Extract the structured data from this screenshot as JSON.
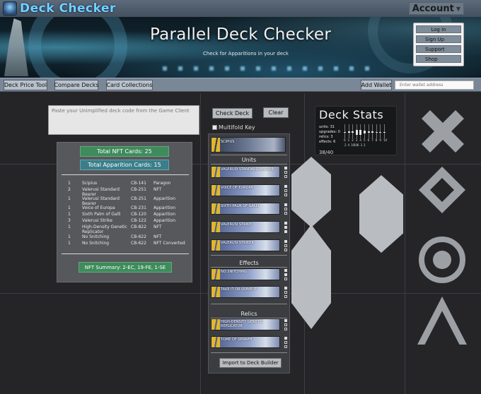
{
  "app": {
    "title": "Deck Checker",
    "account_label": "Account"
  },
  "banner": {
    "title": "Parallel Deck Checker",
    "subtitle": "Check for Apparitions in your deck"
  },
  "auth": {
    "login": "Log In",
    "signup": "Sign Up",
    "support": "Support",
    "shop": "Shop"
  },
  "toolbar": {
    "price_tool": "Deck Price Tool",
    "compare": "Compare Decks",
    "collections": "Card Collections",
    "add_wallet": "Add Wallet",
    "wallet_placeholder": "Enter wallet address"
  },
  "paste": {
    "placeholder": "Paste your Unimplified deck code from the Game Client"
  },
  "nft_panel": {
    "total_nft": "Total NFT Cards: 25",
    "total_apparition": "Total Apparition Cards: 15",
    "cards": [
      {
        "qty": "1",
        "name": "Scipius",
        "code": "CB-141",
        "type": "Paragon"
      },
      {
        "qty": "2",
        "name": "Valerusi Standard Bearer",
        "code": "CB-251",
        "type": "NFT"
      },
      {
        "qty": "1",
        "name": "Valerusi Standard Bearer",
        "code": "CB-251",
        "type": "Apparition"
      },
      {
        "qty": "1",
        "name": "Voice of Europa",
        "code": "CB-231",
        "type": "Apparition"
      },
      {
        "qty": "1",
        "name": "Sixth Palm of Galli",
        "code": "CB-120",
        "type": "Apparition"
      },
      {
        "qty": "3",
        "name": "Valerusi Strike",
        "code": "CB-122",
        "type": "Apparition"
      },
      {
        "qty": "1",
        "name": "High-Density Genetic Replicator",
        "code": "CB-822",
        "type": "NFT"
      },
      {
        "qty": "1",
        "name": "No Snitching",
        "code": "CB-622",
        "type": "NFT"
      },
      {
        "qty": "1",
        "name": "No Snitching",
        "code": "CB-622",
        "type": "NFT Converted"
      }
    ],
    "summary": "NFT Summary: 2-EC, 19-FE, 1-SE"
  },
  "deck": {
    "check_label": "Check Deck",
    "clear_label": "Clear",
    "multifold_label": "Multifold Key",
    "paragon": "Scipius",
    "sections": {
      "units": "Units",
      "effects": "Effects",
      "relics": "Relics"
    },
    "units": [
      "Valerusi Standard Bearer",
      "Voice of Europa",
      "Sixth Palm of Galli",
      "Valerusi Strike",
      "Valerusi Striker"
    ],
    "effects": [
      "No Snitching",
      "Take It or Leave It"
    ],
    "relics": [
      "High-Density Genetic Replicator",
      "Tome of Seraph"
    ],
    "import_label": "Import to Deck Builder"
  },
  "stats": {
    "title": "Deck Stats",
    "units": "units: 31",
    "upgrades": "upgrades: 0",
    "relics": "relics: 3",
    "effects": "effects: 6",
    "count": "38/40",
    "cost_ticks": [
      "0",
      "1",
      "2",
      "3",
      "4",
      "5",
      "6",
      "7",
      "8",
      "9",
      "10"
    ],
    "bar_counts": [
      "2",
      "4",
      "10",
      "10",
      "6",
      "3",
      "2"
    ]
  },
  "chart_data": {
    "type": "bar",
    "categories": [
      "0",
      "1",
      "2",
      "3",
      "4",
      "5",
      "6",
      "7",
      "8",
      "9",
      "10"
    ],
    "values": [
      0,
      2,
      4,
      10,
      10,
      6,
      3,
      2,
      0,
      0,
      0
    ]
  }
}
